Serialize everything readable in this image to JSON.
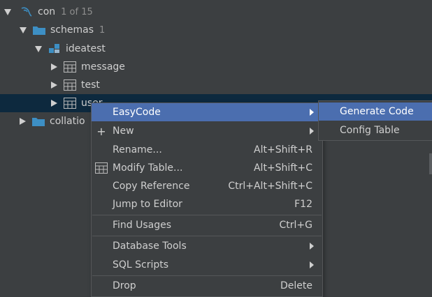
{
  "tree": {
    "root": {
      "label": "con",
      "count": "1 of 15"
    },
    "schemas": {
      "label": "schemas",
      "count": "1"
    },
    "db": {
      "label": "ideatest"
    },
    "tables": [
      {
        "label": "message"
      },
      {
        "label": "test"
      },
      {
        "label": "user"
      }
    ],
    "collations": {
      "label": "collatio"
    }
  },
  "context_menu": {
    "items": [
      {
        "label": "EasyCode",
        "shortcut": "",
        "submenu": true,
        "active": true
      },
      {
        "label": "New",
        "shortcut": "",
        "submenu": true,
        "icon": "plus-icon"
      },
      {
        "label": "Rename...",
        "shortcut": "Alt+Shift+R"
      },
      {
        "label": "Modify Table...",
        "shortcut": "Alt+Shift+C",
        "icon": "table-icon"
      },
      {
        "label": "Copy Reference",
        "shortcut": "Ctrl+Alt+Shift+C"
      },
      {
        "label": "Jump to Editor",
        "shortcut": "F12"
      },
      {
        "label": "Find Usages",
        "shortcut": "Ctrl+G"
      },
      {
        "label": "Database Tools",
        "shortcut": "",
        "submenu": true
      },
      {
        "label": "SQL Scripts",
        "shortcut": "",
        "submenu": true
      },
      {
        "label": "Drop",
        "shortcut": "Delete"
      }
    ]
  },
  "submenu": {
    "items": [
      {
        "label": "Generate Code",
        "active": true
      },
      {
        "label": "Config Table"
      }
    ]
  },
  "colors": {
    "background": "#3c3f41",
    "selection_row": "#0d293e",
    "menu_highlight": "#4b6eaf",
    "folder_icon": "#3d8fc4",
    "text": "#cfcfcf"
  }
}
